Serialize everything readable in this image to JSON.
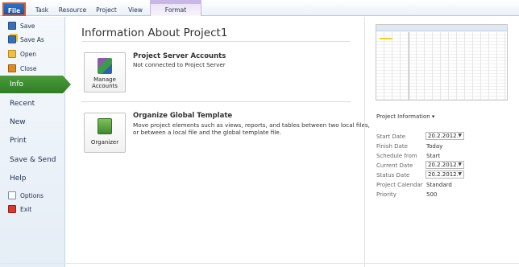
{
  "ribbon": {
    "tabs": [
      "File",
      "Task",
      "Resource",
      "Project",
      "View",
      "Format"
    ]
  },
  "nav": {
    "save": "Save",
    "save_as": "Save As",
    "open": "Open",
    "close": "Close",
    "info": "Info",
    "recent": "Recent",
    "new": "New",
    "print": "Print",
    "save_send": "Save & Send",
    "help": "Help",
    "options": "Options",
    "exit": "Exit"
  },
  "main": {
    "title": "Information About Project1",
    "accounts": {
      "button_line1": "Manage",
      "button_line2": "Accounts",
      "heading": "Project Server Accounts",
      "text": "Not connected to Project Server"
    },
    "global": {
      "button": "Organizer",
      "heading": "Organize Global Template",
      "text_line1": "Move project elements such as views, reports, and tables between two local files,",
      "text_line2": "or between a local file and the global template file."
    }
  },
  "project_info": {
    "header": "Project Information ▾",
    "start_date_label": "Start Date",
    "start_date_value": "20.2.2012.",
    "finish_date_label": "Finish Date",
    "finish_date_value": "Today",
    "schedule_from_label": "Schedule from",
    "schedule_from_value": "Start",
    "current_date_label": "Current Date",
    "current_date_value": "20.2.2012.",
    "status_date_label": "Status Date",
    "status_date_value": "20.2.2012.",
    "calendar_label": "Project Calendar",
    "calendar_value": "Standard",
    "priority_label": "Priority",
    "priority_value": "500"
  },
  "icons": {
    "save": "save-icon",
    "save_as": "save-as-icon",
    "open": "open-folder-icon",
    "close": "close-file-icon",
    "options": "options-icon",
    "exit": "exit-icon",
    "manage_accounts": "manage-accounts-icon",
    "organizer": "organizer-icon",
    "dropdown": "chevron-down-icon"
  },
  "colors": {
    "file_tab": "#1a56a8",
    "file_tab_border": "#e2531e",
    "info_selected": "#2f7d25",
    "context_tab": "#c9b7e8"
  }
}
